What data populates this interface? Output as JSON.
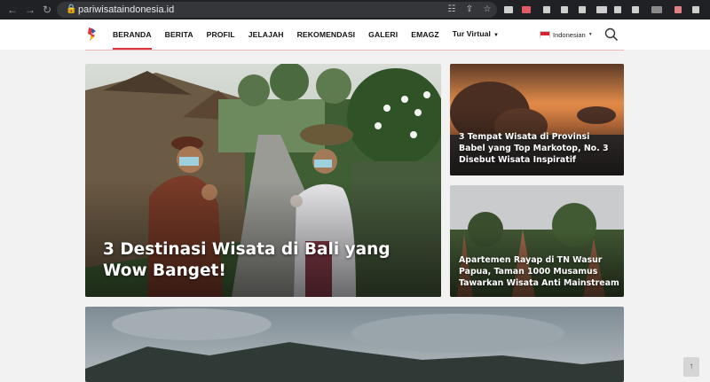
{
  "browser": {
    "url": "pariwisataindonesia.id"
  },
  "site": {
    "menu": [
      {
        "label": "BERANDA"
      },
      {
        "label": "BERITA"
      },
      {
        "label": "PROFIL"
      },
      {
        "label": "JELAJAH"
      },
      {
        "label": "REKOMENDASI"
      },
      {
        "label": "GALERI"
      },
      {
        "label": "EMAGZ"
      },
      {
        "label": "Tur Virtual"
      }
    ],
    "active_menu": "BERANDA",
    "language": "Indonesian",
    "accent_color": "#e2343f"
  },
  "articles": {
    "featured": {
      "title": "3 Destinasi Wisata di Bali yang Wow Banget!"
    },
    "side_top": {
      "title": "3 Tempat Wisata di Provinsi Babel yang Top Markotop, No. 3 Disebut Wisata Inspiratif"
    },
    "side_bottom": {
      "title": "Apartemen Rayap di TN Wasur Papua, Taman 1000 Musamus Tawarkan Wisata Anti Mainstream"
    }
  }
}
